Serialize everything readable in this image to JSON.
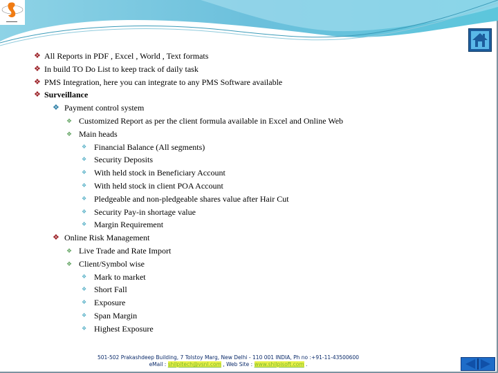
{
  "slide": {
    "nav": {
      "home_icon": "home-icon",
      "prev_icon": "prev-slide-icon",
      "next_icon": "next-slide-icon"
    },
    "logo_icon": "company-logo",
    "bullets": [
      {
        "level": 1,
        "text": "All Reports in PDF , Excel , World , Text formats",
        "bold": false
      },
      {
        "level": 1,
        "text": "In build TO Do List to keep track of daily task",
        "bold": false
      },
      {
        "level": 1,
        "text": "PMS Integration, here you can integrate to any PMS Software available",
        "bold": false
      },
      {
        "level": 1,
        "text": "Surveillance",
        "bold": true
      },
      {
        "level": 2,
        "text": "Payment control system",
        "bold": false
      },
      {
        "level": 3,
        "text": "Customized Report as per the client formula available in Excel and Online Web",
        "bold": false
      },
      {
        "level": 3,
        "text": "Main heads",
        "bold": false
      },
      {
        "level": 4,
        "text": "Financial Balance (All segments)",
        "bold": false
      },
      {
        "level": 4,
        "text": "Security Deposits",
        "bold": false
      },
      {
        "level": 4,
        "text": "With held stock in Beneficiary Account",
        "bold": false
      },
      {
        "level": 4,
        "text": "With held stock in client POA Account",
        "bold": false
      },
      {
        "level": 4,
        "text": "Pledgeable and non-pledgeable shares value after Hair Cut",
        "bold": false
      },
      {
        "level": 4,
        "text": "Security Pay-in shortage value",
        "bold": false
      },
      {
        "level": 4,
        "text": "Margin Requirement",
        "bold": false
      },
      {
        "level": 2,
        "text": "Online Risk Management",
        "bold": false,
        "bullet_color": "#9a1e24"
      },
      {
        "level": 3,
        "text": "Live Trade and Rate Import",
        "bold": false
      },
      {
        "level": 3,
        "text": "Client/Symbol wise",
        "bold": false
      },
      {
        "level": 4,
        "text": "Mark to market",
        "bold": false
      },
      {
        "level": 4,
        "text": "Short Fall",
        "bold": false
      },
      {
        "level": 4,
        "text": "Exposure",
        "bold": false
      },
      {
        "level": 4,
        "text": "Span Margin",
        "bold": false
      },
      {
        "level": 4,
        "text": "Highest Exposure",
        "bold": false
      }
    ],
    "footer": {
      "address": "501-502 Prakashdeep Building, 7 Tolstoy Marg, New Delhi - 110 001 INDIA,  Ph no :+91-11-43500600",
      "email_label": "eMail : ",
      "email": "shilpitech@vsnl.com",
      "web_label": " , Web Site : ",
      "website": "www.shilpisoft.com",
      "trailer": " ."
    },
    "colors": {
      "bullet_level1": "#9a1e24",
      "bullet_level2": "#2e7fa6",
      "bullet_level3": "#6aa86a",
      "bullet_level4": "#5ab2c8",
      "header_wave": "#6cc0dc",
      "nav_button": "#1e6cc8"
    }
  }
}
